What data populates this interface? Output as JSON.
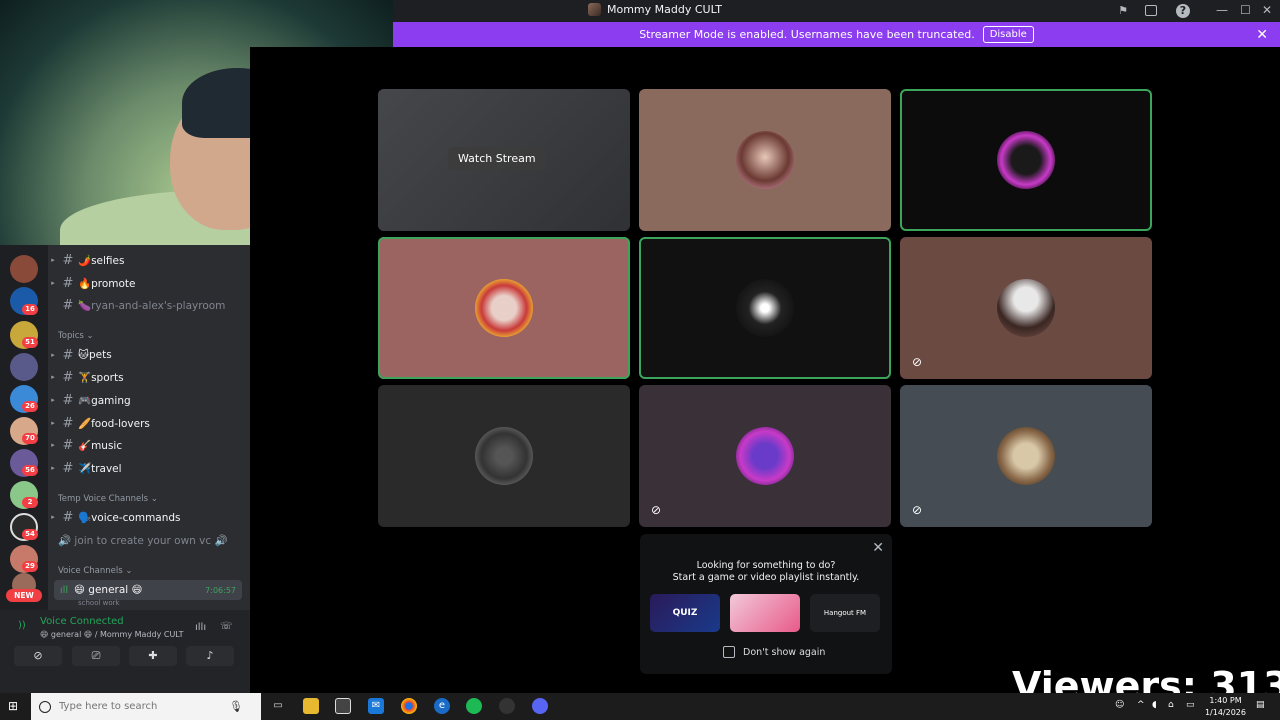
{
  "window": {
    "title": "Mommy Maddy CULT",
    "icons": [
      "flag-icon",
      "inbox-icon",
      "help-icon"
    ],
    "controls": [
      "—",
      "☐",
      "✕"
    ]
  },
  "streamer_banner": {
    "text": "Streamer Mode is enabled. Usernames have been truncated.",
    "button": "Disable",
    "close": "✕"
  },
  "stage": {
    "watch_stream": "Watch Stream",
    "tiles": [
      {
        "id": "stream",
        "bg": "#3a3b3f",
        "speaking": false,
        "muted": false
      },
      {
        "id": "p1",
        "bg": "#8a6a5c",
        "speaking": false,
        "muted": false
      },
      {
        "id": "p2",
        "bg": "#0c0c0c",
        "speaking": true,
        "muted": false
      },
      {
        "id": "p3",
        "bg": "#9c6460",
        "speaking": true,
        "muted": false
      },
      {
        "id": "p4",
        "bg": "#111111",
        "speaking": true,
        "muted": false
      },
      {
        "id": "p5",
        "bg": "#6b4a42",
        "speaking": false,
        "muted": true
      },
      {
        "id": "p6",
        "bg": "#2a2a2a",
        "speaking": false,
        "muted": false
      },
      {
        "id": "p7",
        "bg": "#3a3138",
        "speaking": false,
        "muted": true
      },
      {
        "id": "p8",
        "bg": "#454c54",
        "speaking": false,
        "muted": true
      }
    ]
  },
  "activity": {
    "line1": "Looking for something to do?",
    "line2": "Start a game or video playlist instantly.",
    "thumbs": [
      "QUIZ",
      "",
      "Hangout FM"
    ],
    "dont_show": "Don't show again",
    "close": "✕"
  },
  "channels": {
    "items": [
      {
        "arrow": "▸",
        "name": "🌶️selfies",
        "muted": false
      },
      {
        "arrow": "▸",
        "name": "🔥promote",
        "muted": false
      },
      {
        "arrow": "",
        "name": "🍆ryan-and-alex's-playroom",
        "muted": true
      }
    ],
    "topics_label": "Topics ⌄",
    "topics": [
      {
        "name": "🐱pets"
      },
      {
        "name": "🏋️sports"
      },
      {
        "name": "🎮gaming"
      },
      {
        "name": "🥖food-lovers"
      },
      {
        "name": "🎸music"
      },
      {
        "name": "✈️travel"
      }
    ],
    "temp_label": "Temp Voice Channels ⌄",
    "voice_commands": "🗣️voice-commands",
    "join_create": "🔊 join to create your own vc 🔊",
    "voice_label": "Voice Channels ⌄",
    "general": "😄 general 😄",
    "general_timer": "7:06:57",
    "general_sub": "school work"
  },
  "server_badges": [
    "16",
    "51",
    "26",
    "70",
    "56",
    "2",
    "54",
    "29"
  ],
  "new_badge": "NEW",
  "voice_panel": {
    "title": "Voice Connected",
    "sub": "😄 general 😄 / Mommy Maddy CULT"
  },
  "viewers": "Viewers: 313",
  "taskbar": {
    "search_placeholder": "Type here to search",
    "time": "1:40 PM",
    "date": "1/14/2026"
  }
}
